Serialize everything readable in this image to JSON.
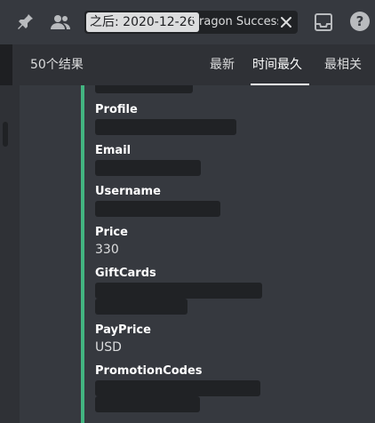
{
  "toolbar": {
    "icons": [
      "pin-icon",
      "members-icon",
      "inbox-icon",
      "help-icon"
    ],
    "search": {
      "filter_chip": "之后: 2020-12-26",
      "query": "Dragon Success!"
    }
  },
  "results": {
    "count_label": "50个结果",
    "tabs": [
      {
        "label": "最新",
        "active": false
      },
      {
        "label": "时间最久",
        "active": true
      },
      {
        "label": "最相关",
        "active": false
      }
    ]
  },
  "message": {
    "accent_color": "#43b581",
    "fields": [
      {
        "name": "Profile",
        "value": ""
      },
      {
        "name": "Email",
        "value": ""
      },
      {
        "name": "Username",
        "value": ""
      },
      {
        "name": "Price",
        "value": "330"
      },
      {
        "name": "GiftCards",
        "value": ""
      },
      {
        "name": "PayPrice",
        "value": "USD"
      },
      {
        "name": "PromotionCodes",
        "value": ""
      }
    ]
  }
}
